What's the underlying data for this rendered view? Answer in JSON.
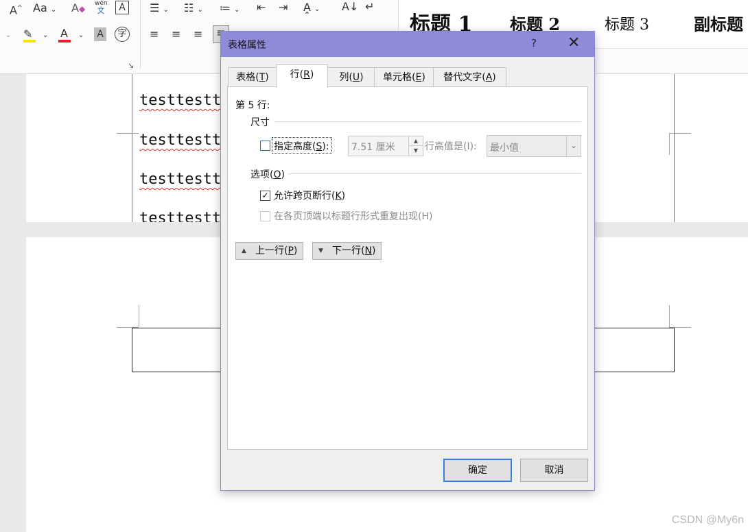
{
  "ribbon": {
    "font_grow": "A",
    "change_case": "Aa",
    "phonetic_top": "wén",
    "phonetic_bottom": "文",
    "char_border": "A",
    "font_color": "A",
    "shade": "A",
    "enclose": "字",
    "highlight_color": "#f2e600",
    "font_color_value": "#e3202b",
    "styles": [
      "标题 1",
      "标题 2",
      "标题 3",
      "副标题"
    ]
  },
  "document": {
    "lines": [
      "testtestte",
      "testtestte",
      "testtestte",
      "testtestte"
    ]
  },
  "dialog": {
    "title": "表格属性",
    "help": "?",
    "close": "✕",
    "tabs": [
      {
        "pre": "表格(",
        "key": "T",
        "post": ")"
      },
      {
        "pre": "行(",
        "key": "R",
        "post": ")"
      },
      {
        "pre": "列(",
        "key": "U",
        "post": ")"
      },
      {
        "pre": "单元格(",
        "key": "E",
        "post": ")"
      },
      {
        "pre": "替代文字(",
        "key": "A",
        "post": ")"
      }
    ],
    "row_label": "第 5 行:",
    "size_group": "尺寸",
    "specify_height": {
      "pre": "指定高度(",
      "key": "S",
      "post": "):"
    },
    "height_value": "7.51 厘米",
    "row_height_is": "行高值是(I):",
    "row_height_mode": "最小值",
    "options_group": {
      "pre": "选项(",
      "key": "O",
      "post": ")"
    },
    "allow_break": {
      "pre": "允许跨页断行(",
      "key": "K",
      "post": ")"
    },
    "allow_break_checked": true,
    "repeat_header": "在各页顶端以标题行形式重复出现(H)",
    "prev_row": {
      "pre": "上一行(",
      "key": "P",
      "post": ")"
    },
    "next_row": {
      "pre": "下一行(",
      "key": "N",
      "post": ")"
    },
    "ok": "确定",
    "cancel": "取消"
  },
  "watermark": "CSDN @My6n"
}
